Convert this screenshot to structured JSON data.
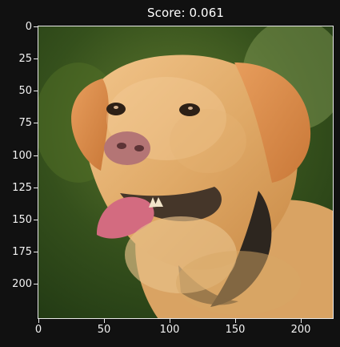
{
  "figure": {
    "title": "Score: 0.061"
  },
  "axes": {
    "x_ticks": [
      "0",
      "50",
      "100",
      "150",
      "200"
    ],
    "y_ticks": [
      "0",
      "25",
      "50",
      "75",
      "100",
      "125",
      "150",
      "175",
      "200"
    ]
  },
  "image": {
    "subject": "golden-labrador-dog-photo",
    "background_color": "#425f1f",
    "fur_color": "#e1b06d",
    "tongue_color": "#d8647d",
    "collar_color": "#2c2621"
  }
}
